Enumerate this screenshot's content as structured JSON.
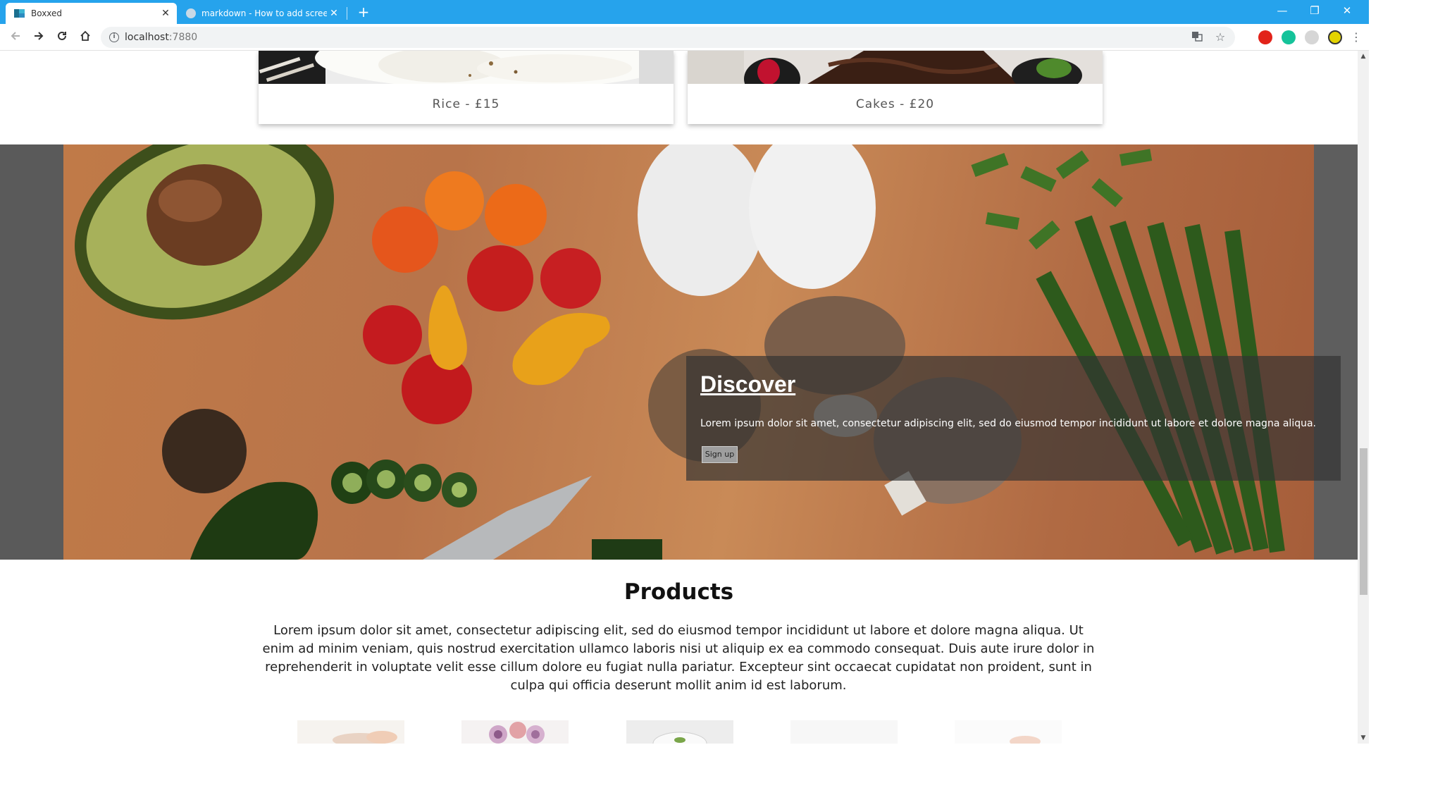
{
  "browser": {
    "tabs": [
      {
        "title": "Boxxed",
        "active": true
      },
      {
        "title": "markdown - How to add screens",
        "active": false
      }
    ],
    "url_host": "localhost",
    "url_port": ":7880",
    "new_tab_symbol": "+",
    "close_symbol": "✕",
    "window_controls": {
      "minimize": "—",
      "restore": "❐",
      "close": "✕"
    }
  },
  "cards": [
    {
      "caption": "Rice - £15",
      "image": "rice-bowl"
    },
    {
      "caption": "Cakes - £20",
      "image": "chocolate-cake"
    }
  ],
  "hero": {
    "title": "Discover",
    "text": "Lorem ipsum dolor sit amet, consectetur adipiscing elit, sed do eiusmod tempor incididunt ut labore et dolore magna aliqua.",
    "button_label": "Sign up"
  },
  "products": {
    "title": "Products",
    "text": "Lorem ipsum dolor sit amet, consectetur adipiscing elit, sed do eiusmod tempor incididunt ut labore et dolore magna aliqua. Ut enim ad minim veniam, quis nostrud exercitation ullamco laboris nisi ut aliquip ex ea commodo consequat. Duis aute irure dolor in reprehenderit in voluptate velit esse cillum dolore eu fugiat nulla pariatur. Excepteur sint occaecat cupidatat non proident, sunt in culpa qui officia deserunt mollit anim id est laborum.",
    "thumbnails": [
      "sushi-thumb",
      "dessert-thumb",
      "salad-thumb",
      "plain-thumb",
      "dish-thumb"
    ]
  },
  "colors": {
    "tabbar": "#26a3ec",
    "overlay": "rgba(50,50,50,0.68)",
    "board": "#c07a48"
  }
}
